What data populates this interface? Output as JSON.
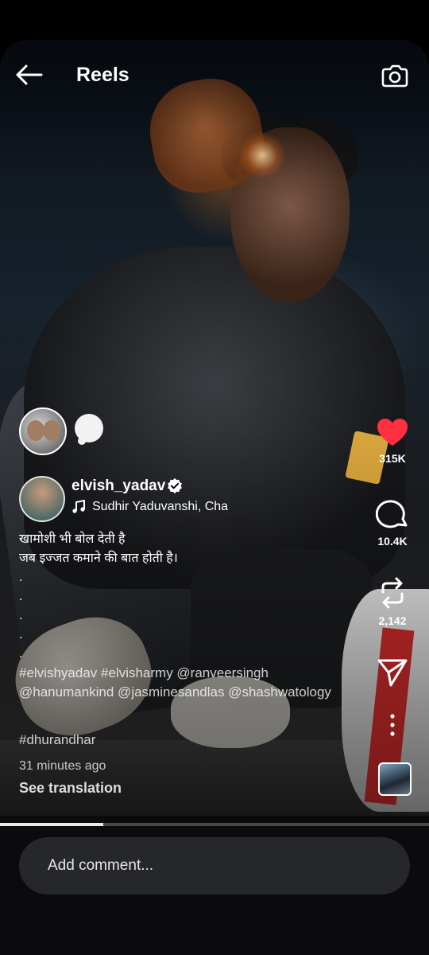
{
  "header": {
    "title": "Reels"
  },
  "post": {
    "username": "elvish_yadav",
    "audio": "Sudhir Yaduvanshi, Cha",
    "caption_lines": [
      "खामोशी भी बोल देती है",
      "जब इज्जत कमाने की बात होती है।"
    ],
    "caption_dots": [
      ".",
      ".",
      ".",
      ".",
      "."
    ],
    "hashtags_line": "#elvishyadav #elvisharmy @ranveersingh @hanumankind @jasminesandlas @shashwatology",
    "hashtag_second": "#dhurandhar",
    "time_ago": "31 minutes ago",
    "see_translation": "See translation"
  },
  "actions": {
    "likes": "315K",
    "comments": "10.4K",
    "reposts": "2,142"
  },
  "progress": {
    "fraction": 0.24
  },
  "comment_bar": {
    "placeholder": "Add comment..."
  },
  "colors": {
    "like": "#ff3040",
    "comment_bar_bg": "#26272b"
  },
  "icons": [
    "back-arrow-icon",
    "camera-icon",
    "verified-badge-icon",
    "music-note-icon",
    "heart-icon",
    "comment-icon",
    "repost-icon",
    "share-icon",
    "more-icon"
  ]
}
